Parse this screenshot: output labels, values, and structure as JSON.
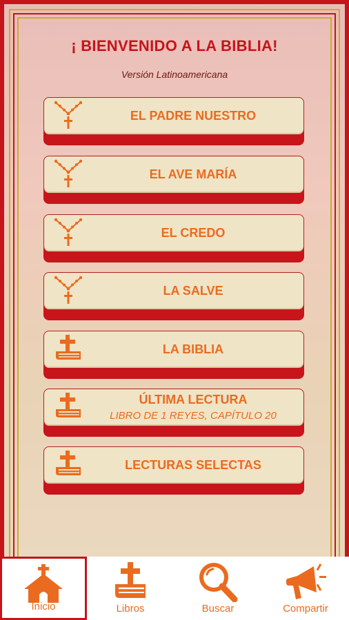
{
  "header": {
    "title": "¡ BIENVENIDO A LA BIBLIA!",
    "subtitle": "Versión Latinoamericana"
  },
  "menu": [
    {
      "id": "padre-nuestro",
      "icon": "rosary-icon",
      "label": "EL PADRE NUESTRO",
      "sublabel": ""
    },
    {
      "id": "ave-maria",
      "icon": "rosary-icon",
      "label": "EL AVE MARÍA",
      "sublabel": ""
    },
    {
      "id": "credo",
      "icon": "rosary-icon",
      "label": "EL CREDO",
      "sublabel": ""
    },
    {
      "id": "salve",
      "icon": "rosary-icon",
      "label": "LA SALVE",
      "sublabel": ""
    },
    {
      "id": "biblia",
      "icon": "bible-icon",
      "label": "LA BIBLIA",
      "sublabel": ""
    },
    {
      "id": "ultima-lectura",
      "icon": "bible-icon",
      "label": "ÚLTIMA LECTURA",
      "sublabel": "LIBRO DE 1 REYES, CAPÍTULO 20"
    },
    {
      "id": "lecturas-selectas",
      "icon": "bible-icon",
      "label": "LECTURAS SELECTAS",
      "sublabel": ""
    }
  ],
  "nav": [
    {
      "id": "inicio",
      "icon": "church-icon",
      "label": "Inicio",
      "active": true
    },
    {
      "id": "libros",
      "icon": "bible-icon",
      "label": "Libros",
      "active": false
    },
    {
      "id": "buscar",
      "icon": "search-icon",
      "label": "Buscar",
      "active": false
    },
    {
      "id": "compartir",
      "icon": "megaphone-icon",
      "label": "Compartir",
      "active": false
    }
  ],
  "colors": {
    "accent": "#ea6b1f",
    "frame_red": "#c5141a",
    "frame_gold": "#c9a93a",
    "button_face": "#efe4c6"
  }
}
